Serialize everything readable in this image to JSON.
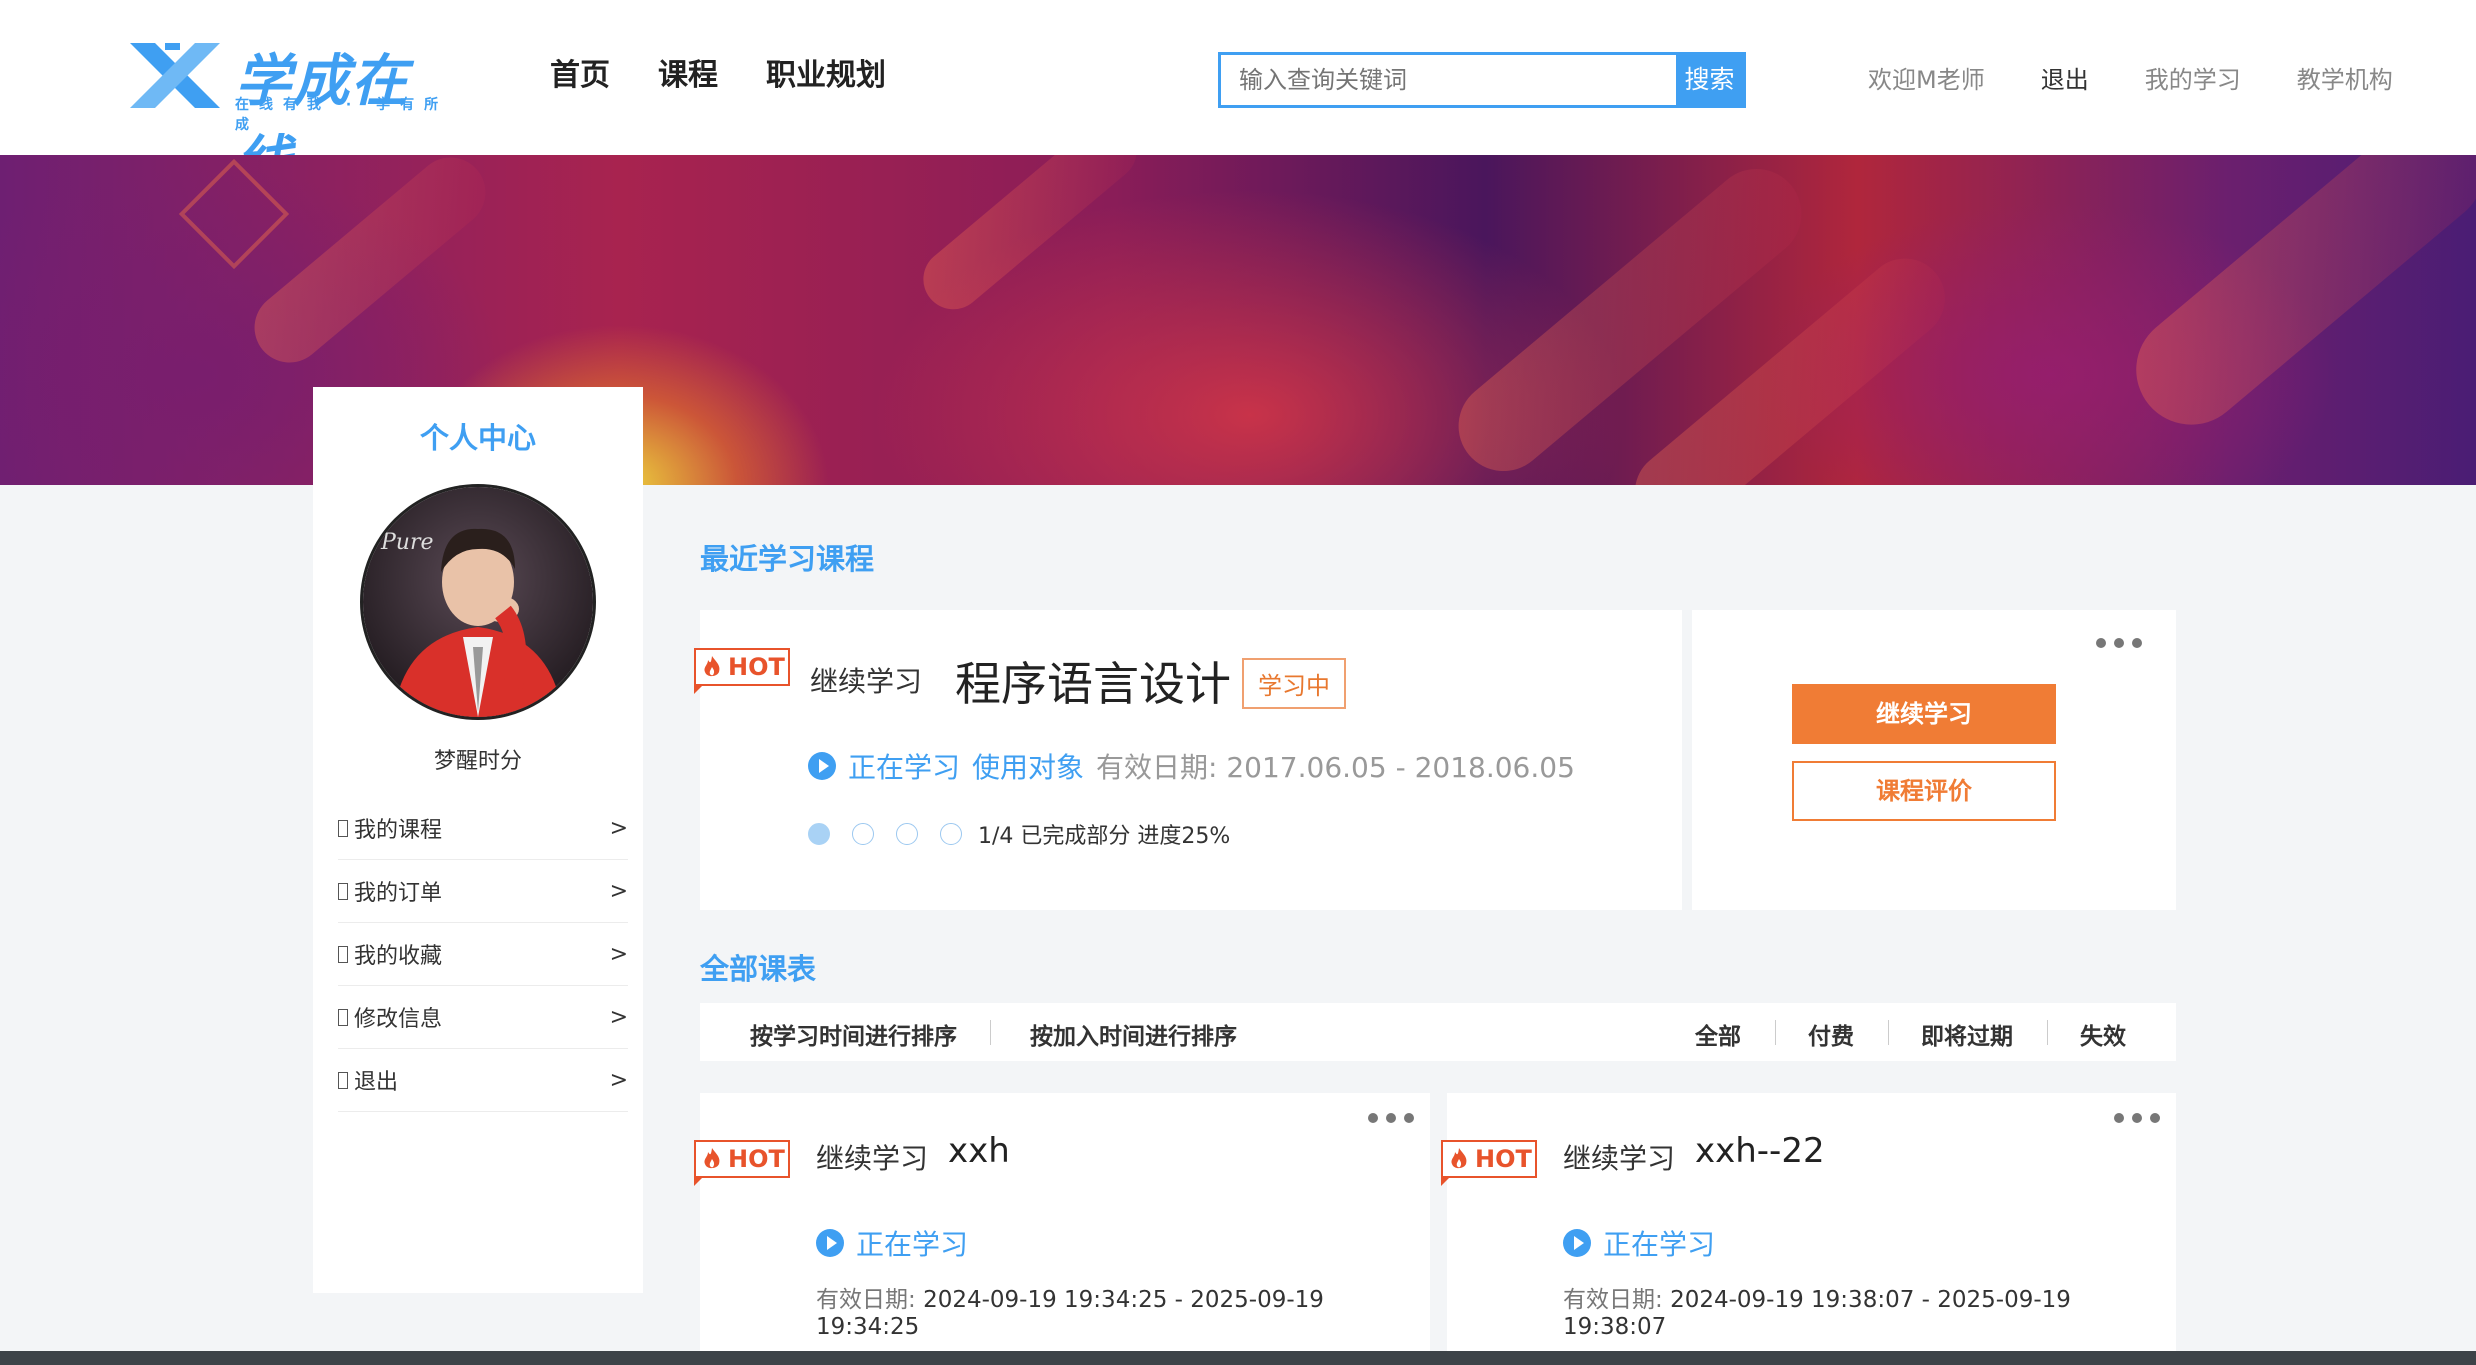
{
  "header": {
    "brand": "学成在线",
    "slogan": "在线有我 · 学有所成",
    "nav": [
      "首页",
      "课程",
      "职业规划"
    ],
    "search_placeholder": "输入查询关键词",
    "search_button": "搜索",
    "welcome": "欢迎M老师",
    "logout": "退出",
    "my_learning": "我的学习",
    "institution": "教学机构"
  },
  "sidebar": {
    "title": "个人中心",
    "username": "梦醒时分",
    "items": [
      {
        "label": "我的课程",
        "arrow": ">"
      },
      {
        "label": "我的订单",
        "arrow": ">"
      },
      {
        "label": "我的收藏",
        "arrow": ">"
      },
      {
        "label": "修改信息",
        "arrow": ">"
      },
      {
        "label": "退出",
        "arrow": ">"
      }
    ]
  },
  "recent": {
    "section_title": "最近学习课程",
    "hot": "HOT",
    "continue": "继续学习",
    "course_title": "程序语言设计",
    "badge": "学习中",
    "status": "正在学习",
    "audience": "使用对象",
    "validity": "有效日期: 2017.06.05 - 2018.06.05",
    "progress_text": "1/4 已完成部分 进度25%",
    "progress": 0.25,
    "btn_continue": "继续学习",
    "btn_review": "课程评价"
  },
  "all": {
    "section_title": "全部课表",
    "sort_by_study": "按学习时间进行排序",
    "sort_by_join": "按加入时间进行排序",
    "filters": [
      "全部",
      "付费",
      "即将过期",
      "失效"
    ],
    "courses": [
      {
        "hot": "HOT",
        "continue": "继续学习",
        "title": "xxh",
        "status": "正在学习",
        "validity_label": "有效日期:",
        "validity": "2024-09-19 19:34:25 - 2025-09-19 19:34:25"
      },
      {
        "hot": "HOT",
        "continue": "继续学习",
        "title": "xxh--22",
        "status": "正在学习",
        "validity_label": "有效日期:",
        "validity": "2024-09-19 19:38:07 - 2025-09-19 19:38:07"
      }
    ]
  },
  "colors": {
    "accent": "#3f9ff2",
    "orange": "#f07c35",
    "hot": "#e8532b"
  }
}
